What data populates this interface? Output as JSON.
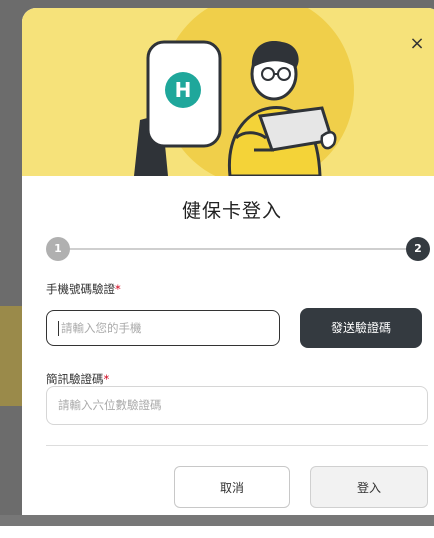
{
  "colors": {
    "hero_background": "#f6e27a",
    "primary_dark": "#343a40",
    "required_star": "#d0021b"
  },
  "hero": {
    "illustration": "person-with-laptop-and-health-card-illustration",
    "logo_letter": "H"
  },
  "close_icon": "×",
  "title": "健保卡登入",
  "stepper": {
    "step1": "1",
    "step2": "2"
  },
  "phone_field": {
    "label": "手機號碼驗證",
    "required": "*",
    "placeholder": "請輸入您的手機"
  },
  "send_button": "發送驗證碼",
  "code_field": {
    "label": "簡訊驗證碼",
    "required": "*",
    "placeholder": "請輸入六位數驗證碼"
  },
  "buttons": {
    "cancel": "取消",
    "login": "登入"
  }
}
